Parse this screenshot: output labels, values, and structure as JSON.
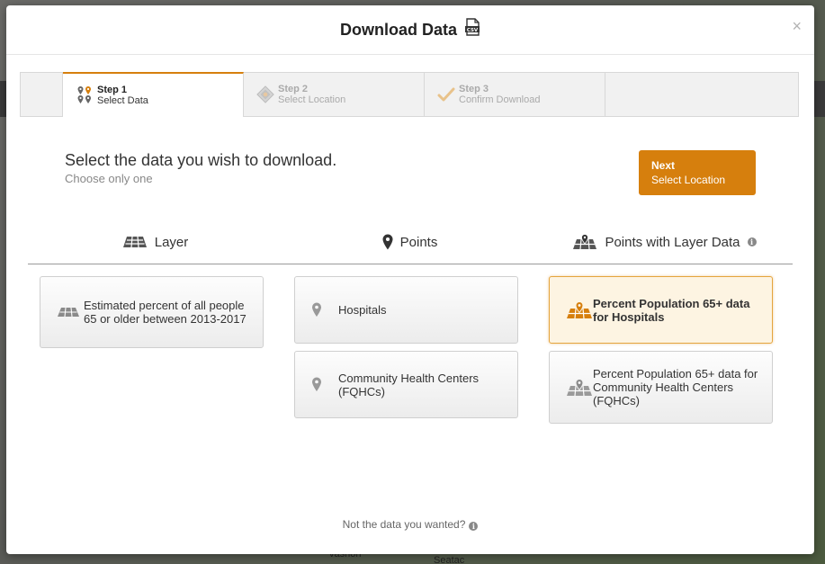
{
  "background": {
    "map_labels": [
      "Vashon",
      "Seatac"
    ]
  },
  "modal": {
    "title": "Download Data",
    "csv_icon": "csv-file-icon",
    "close_label": "×"
  },
  "steps": [
    {
      "num": "Step 1",
      "name": "Select Data",
      "state": "active",
      "icon": "map-pins-icon"
    },
    {
      "num": "Step 2",
      "name": "Select Location",
      "state": "inactive",
      "icon": "map-location-icon"
    },
    {
      "num": "Step 3",
      "name": "Confirm Download",
      "state": "inactive",
      "icon": "checkmark-icon"
    }
  ],
  "heading": {
    "title": "Select the data you wish to download.",
    "subtitle": "Choose only one"
  },
  "next_button": {
    "line1": "Next",
    "line2": "Select Location"
  },
  "columns": [
    {
      "label": "Layer",
      "icon": "layer-icon"
    },
    {
      "label": "Points",
      "icon": "pin-icon"
    },
    {
      "label": "Points with Layer Data",
      "icon": "points-layer-icon",
      "info": "i"
    }
  ],
  "cards": {
    "layer": [
      {
        "label": "Estimated percent of all people 65 or older between 2013-2017",
        "selected": false
      }
    ],
    "points": [
      {
        "label": "Hospitals",
        "selected": false
      },
      {
        "label": "Community Health Centers (FQHCs)",
        "selected": false
      }
    ],
    "points_layer": [
      {
        "label": "Percent Population 65+ data for Hospitals",
        "selected": true
      },
      {
        "label": "Percent Population 65+ data for Community Health Centers (FQHCs)",
        "selected": false
      }
    ]
  },
  "footer": {
    "note": "Not the data you wanted?",
    "info": "i"
  },
  "colors": {
    "accent": "#d67f0d",
    "selected_bg": "#fdf4e2",
    "selected_border": "#e5a53d"
  }
}
